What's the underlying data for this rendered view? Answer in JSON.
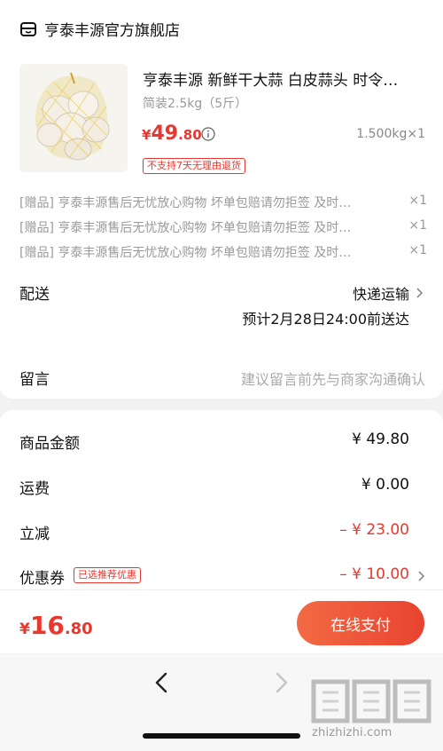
{
  "store": {
    "name": "亨泰丰源官方旗舰店",
    "product": {
      "title": "亨泰丰源 新鲜干大蒜 白皮蒜头 时令…",
      "spec": "简装2.5kg（5斤）",
      "price_currency": "¥",
      "price_int": "49",
      "price_dec": ".80",
      "quantity": "1.500kg×1",
      "no_return_tag": "不支持7天无理由退货"
    },
    "gifts": [
      {
        "text": "[赠品] 亨泰丰源售后无忧放心购物 坏单包赔请勿拒签 及时…",
        "qty": "×1"
      },
      {
        "text": "[赠品] 亨泰丰源售后无忧放心购物 坏单包赔请勿拒签 及时…",
        "qty": "×1"
      },
      {
        "text": "[赠品] 亨泰丰源售后无忧放心购物 坏单包赔请勿拒签 及时…",
        "qty": "×1"
      }
    ],
    "shipping": {
      "label": "配送",
      "method": "快递运输",
      "eta": "预计2月28日24:00前送达"
    },
    "message": {
      "label": "留言",
      "placeholder": "建议留言前先与商家沟通确认"
    }
  },
  "summary": {
    "goods_label": "商品金额",
    "goods_value": "¥ 49.80",
    "freight_label": "运费",
    "freight_value": "¥ 0.00",
    "discount_label": "立减",
    "discount_value": "– ¥ 23.00",
    "coupon_label": "优惠券",
    "coupon_tag": "已选推荐优惠",
    "coupon_value": "– ¥ 10.00"
  },
  "footer": {
    "total_currency": "¥",
    "total_int": "16",
    "total_dec": ".80",
    "pay_label": "在线支付"
  },
  "watermark": {
    "text": "zhizhizhi.com"
  },
  "colors": {
    "accent": "#e6382f",
    "pay_button": "#ec4f35"
  }
}
